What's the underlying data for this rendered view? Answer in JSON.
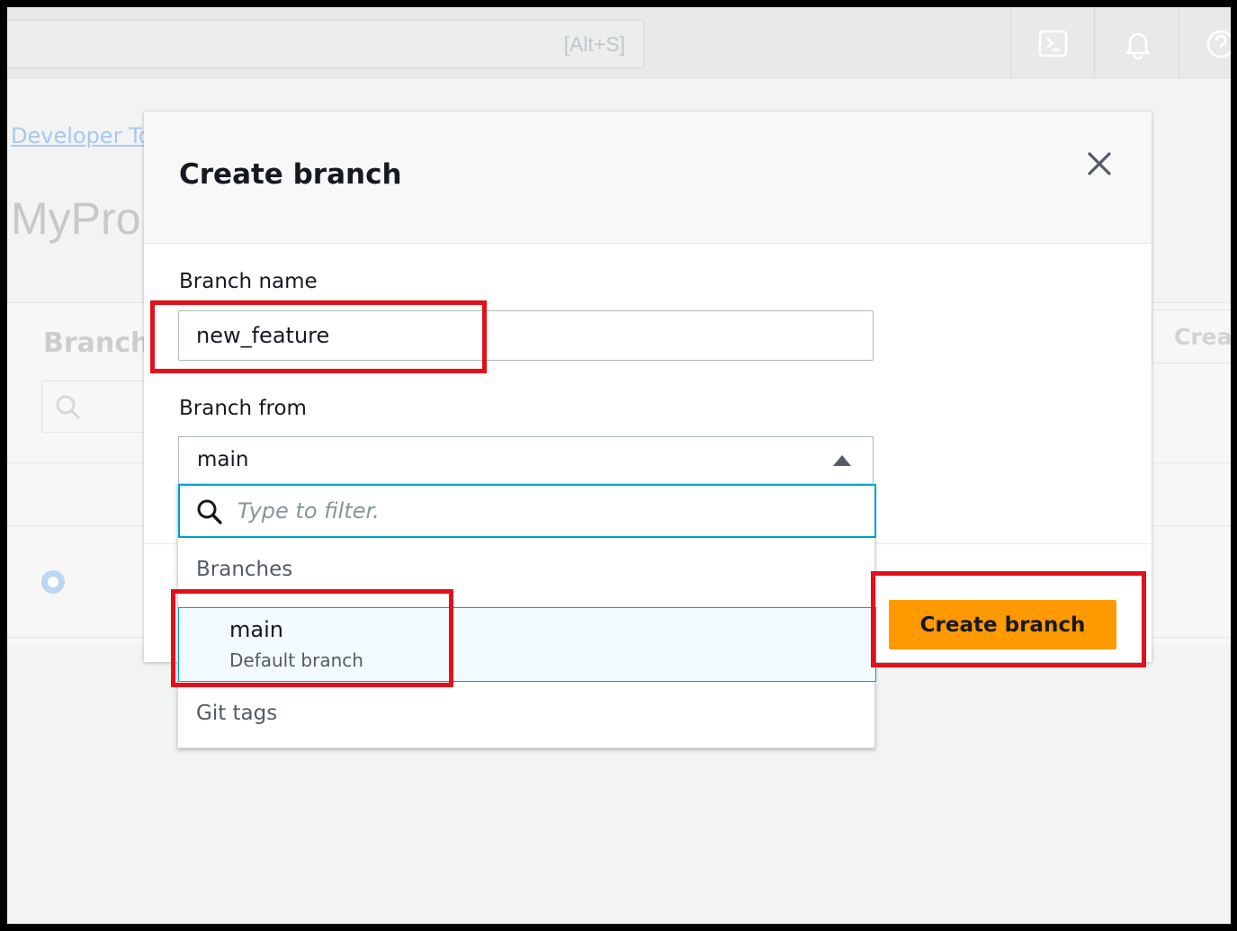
{
  "topbar": {
    "search_shortcut": "[Alt+S]",
    "icons": [
      "cloudshell-icon",
      "bell-icon",
      "help-icon"
    ]
  },
  "background": {
    "breadcrumb": "Developer To",
    "page_title": "MyPro",
    "panel_title": "Branch",
    "create_button_partial": "Crea"
  },
  "modal": {
    "title": "Create branch",
    "branch_name": {
      "label": "Branch name",
      "value": "new_feature"
    },
    "branch_from": {
      "label": "Branch from",
      "selected": "main"
    },
    "dropdown": {
      "filter_placeholder": "Type to filter.",
      "groups": [
        {
          "label": "Branches",
          "options": [
            {
              "name": "main",
              "description": "Default branch"
            }
          ]
        },
        {
          "label": "Git tags",
          "options": []
        }
      ]
    },
    "create_button_label": "Create branch"
  },
  "colors": {
    "primary_button": "#ff9900",
    "focus_border": "#00a1c9",
    "annotation": "#e2101a"
  }
}
